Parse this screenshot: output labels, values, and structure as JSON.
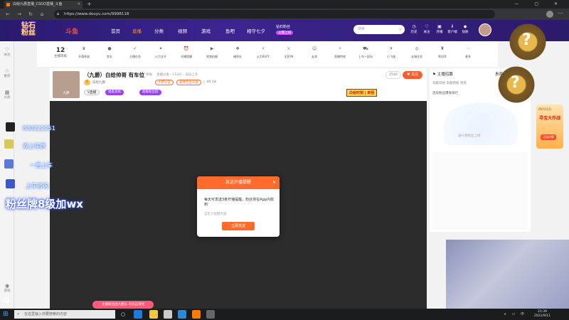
{
  "browser": {
    "tab_title": "白给九爵直播_CSGO直播_斗鱼",
    "url": "https://www.douyu.com/9998118",
    "new_tab": "+",
    "window_controls": "—  ▢  ✕"
  },
  "header": {
    "logo_line1": "钻石",
    "logo_line2": "粉丝",
    "logo_brand": "斗鱼",
    "nav": [
      "首页",
      "直播",
      "分类",
      "视频",
      "游戏",
      "鱼吧",
      "相守七夕"
    ],
    "active_nav": "直播",
    "promo_title": "钻石粉丝",
    "promo_tag": "火爆上线",
    "search_placeholder": "搜索",
    "icons": [
      "历史",
      "关注",
      "开播",
      "客户端",
      "钻粉"
    ]
  },
  "sidebar": {
    "items": [
      "关注",
      "推荐",
      "分类",
      "游戏"
    ]
  },
  "toolbar": {
    "level": "12",
    "level_label": "主播等级",
    "items": [
      "开通贵族",
      "鱼丸",
      "主播任务",
      "火力全开",
      "开播提醒",
      "视频拍摄",
      "福利社",
      "火力BUFF",
      "全民PK",
      "友邦",
      "直播特效",
      "上车一起玩",
      "小飞侠",
      "长城任务",
      "帮冠军",
      "更多"
    ]
  },
  "streamer": {
    "title": "（九爵）白给帅哥 有车位",
    "report": "举报",
    "category": "直播分类 › CSGO › 竞技上车",
    "name": "白给九爵",
    "level_tag": "5",
    "badge1": "大神认证",
    "badge2": "表情包主公会",
    "hot": "44.1w",
    "tag1": "V直播",
    "tag2": "福星高照",
    "tag3": "超级粉丝团",
    "fans_count": "1540",
    "follow_label": "关注",
    "avatar_label": "九爵",
    "recruit": "白给时刻 | 来招"
  },
  "dialog": {
    "title": "发送开播提醒",
    "close": "✕",
    "body": "每天可发送3条开播提醒，粉丝将在App内收到",
    "placeholder": "自定义提醒内容",
    "button": "立即发送"
  },
  "right_panel": {
    "tabs": "主播招募",
    "tab2": "贵宾",
    "sub_tabs": "贡献日榜  贡献周榜  贵宾",
    "rank_title": "连续粉丝爆发排行",
    "hero_text": "送礼物粉丝上榜",
    "side_date": "09月12月",
    "side_title": "寻宝大作战",
    "side_btn": "活动详情"
  },
  "overlay": {
    "qq": "830222251",
    "line1": "双上车群",
    "line2": "一直上车",
    "line3": "上车咨询",
    "fans_text": "粉丝牌8级加wx",
    "notice": "主播粉丝团九爵队  可点击领奖",
    "medal_char": "?"
  },
  "taskbar": {
    "search_placeholder": "在这里输入你要搜索的内容",
    "time": "21:39",
    "date": "2021/9/11",
    "tray": "∧ ▭ 中"
  },
  "colors": {
    "accent": "#ff6b2c",
    "header_bg": "#3b2490",
    "brand": "#ff7a00"
  }
}
